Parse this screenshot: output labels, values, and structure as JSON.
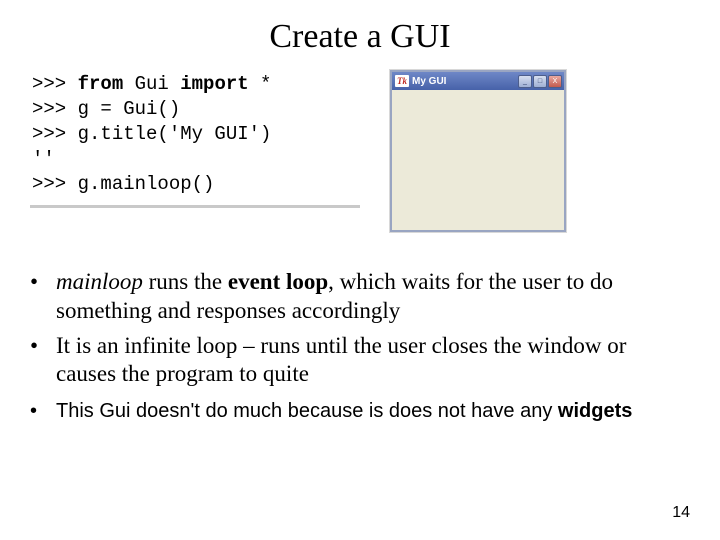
{
  "title": "Create a GUI",
  "code": {
    "line1_prompt": ">>> ",
    "line1_kw1": "from",
    "line1_mid": " Gui ",
    "line1_kw2": "import",
    "line1_end": " *",
    "line2": ">>> g = Gui()",
    "line3": ">>> g.title('My GUI')",
    "line4": "''",
    "line5": ">>> g.mainloop()"
  },
  "gui": {
    "tk_badge": "Tk",
    "title": "My GUI",
    "min_label": "_",
    "max_label": "□",
    "close_label": "X"
  },
  "bullets": {
    "b1_mainloop": "mainloop",
    "b1_mid1": " runs the ",
    "b1_eventloop": "event loop",
    "b1_mid2": ", which waits for the user to do something and responses accordingly",
    "b2": "It is an infinite loop – runs until the user closes the window or causes the program to quite",
    "b3_pre": "This Gui doesn't do much because is does not have any ",
    "b3_widgets": "widgets"
  },
  "page_number": "14"
}
